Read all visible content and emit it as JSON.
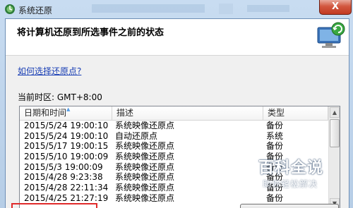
{
  "window": {
    "title": "系统还原",
    "close_symbol": "X"
  },
  "header": {
    "title": "将计算机还原到所选事件之前的状态"
  },
  "help_link": "如何选择还原点?",
  "timezone": "当前时区: GMT+8:00",
  "table": {
    "columns": [
      "日期和时间",
      "描述",
      "类型"
    ],
    "rows": [
      [
        "2015/5/24 19:00:10",
        "系统映像还原点",
        "备份"
      ],
      [
        "2015/5/24 19:00:10",
        "自动还原点",
        "系统"
      ],
      [
        "2015/5/17 19:00:15",
        "系统映像还原点",
        "备份"
      ],
      [
        "2015/5/10 19:00:09",
        "系统映像还原点",
        "备份"
      ],
      [
        "2015/5/3 19:00:09",
        "系统映像还原点",
        "备份"
      ],
      [
        "2015/4/28 9:23:38",
        "系统映像还原点",
        "备份"
      ],
      [
        "2015/4/28 22:11:34",
        "系统映像还原点",
        "备份"
      ],
      [
        "2015/4/25 21:27:19",
        "系统映像还原点",
        "备份"
      ]
    ]
  },
  "watermark": {
    "main": "百科全说",
    "sub": "助你轻松解决"
  },
  "icons": {
    "app": "system-restore-icon",
    "header": "computer-restore-icon"
  },
  "colors": {
    "link": "#1a3fb5",
    "highlight_box": "#e02a2a",
    "close_button": "#c23a22"
  }
}
